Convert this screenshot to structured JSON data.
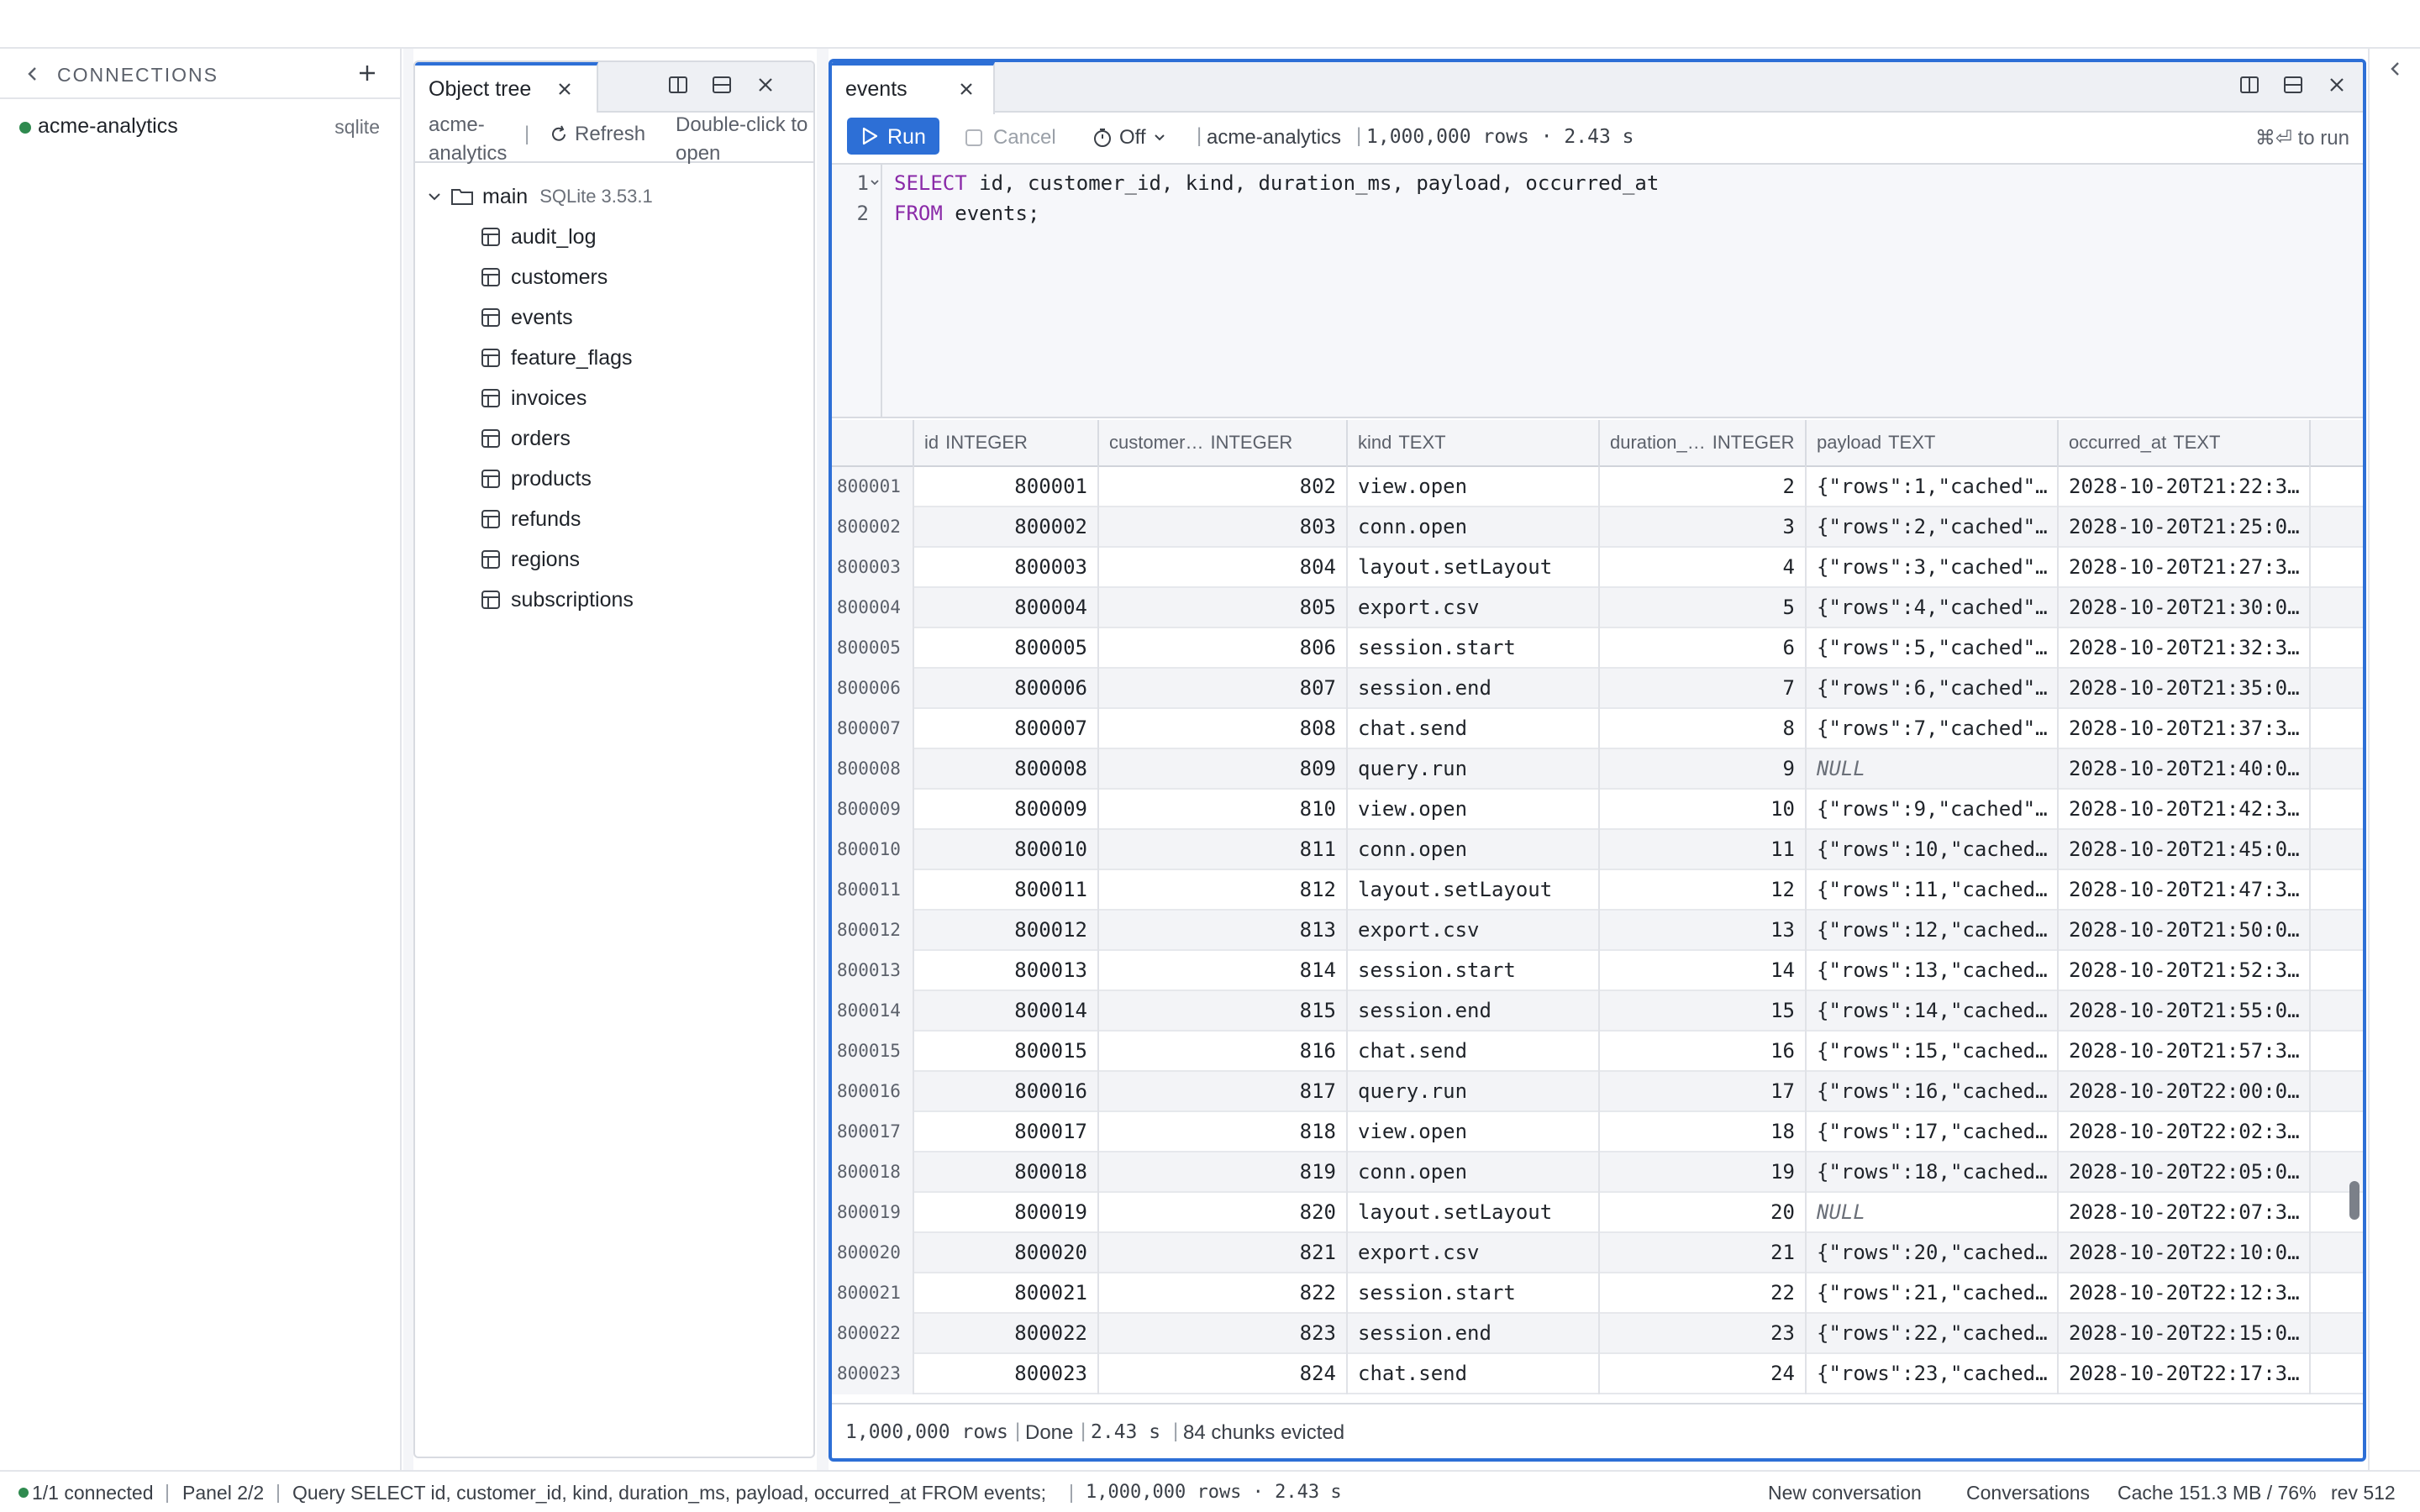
{
  "connections": {
    "title": "CONNECTIONS",
    "items": [
      {
        "name": "acme-analytics",
        "engine": "sqlite",
        "status_color": "#2f8a4f"
      }
    ]
  },
  "tree_panel": {
    "tab_label": "Object tree",
    "db_name": "acme-analytics",
    "refresh_label": "Refresh",
    "hint": "Double-click to open",
    "schema": {
      "name": "main",
      "version": "SQLite 3.53.1"
    },
    "tables": [
      "audit_log",
      "customers",
      "events",
      "feature_flags",
      "invoices",
      "orders",
      "products",
      "refunds",
      "regions",
      "subscriptions"
    ]
  },
  "main_panel": {
    "tab_label": "events",
    "run_label": "Run",
    "cancel_label": "Cancel",
    "timer_label": "Off",
    "connection": "acme-analytics",
    "result_info": "1,000,000 rows · 2.43 s",
    "shortcut_hint": "⌘⏎ to run",
    "editor_lines": [
      {
        "n": "1",
        "kw": "SELECT",
        "rest": " id, customer_id, kind, duration_ms, payload, occurred_at"
      },
      {
        "n": "2",
        "kw": "FROM",
        "rest": " events;"
      }
    ],
    "columns": [
      {
        "name": "id",
        "type": "INTEGER"
      },
      {
        "name": "customer…",
        "type": "INTEGER"
      },
      {
        "name": "kind",
        "type": "TEXT"
      },
      {
        "name": "duration_…",
        "type": "INTEGER"
      },
      {
        "name": "payload",
        "type": "TEXT"
      },
      {
        "name": "occurred_at",
        "type": "TEXT"
      }
    ],
    "rows": [
      [
        "800001",
        "800001",
        "802",
        "view.open",
        "2",
        "{\"rows\":1,\"cached\"…",
        "2028-10-20T21:22:3…"
      ],
      [
        "800002",
        "800002",
        "803",
        "conn.open",
        "3",
        "{\"rows\":2,\"cached\"…",
        "2028-10-20T21:25:0…"
      ],
      [
        "800003",
        "800003",
        "804",
        "layout.setLayout",
        "4",
        "{\"rows\":3,\"cached\"…",
        "2028-10-20T21:27:3…"
      ],
      [
        "800004",
        "800004",
        "805",
        "export.csv",
        "5",
        "{\"rows\":4,\"cached\"…",
        "2028-10-20T21:30:0…"
      ],
      [
        "800005",
        "800005",
        "806",
        "session.start",
        "6",
        "{\"rows\":5,\"cached\"…",
        "2028-10-20T21:32:3…"
      ],
      [
        "800006",
        "800006",
        "807",
        "session.end",
        "7",
        "{\"rows\":6,\"cached\"…",
        "2028-10-20T21:35:0…"
      ],
      [
        "800007",
        "800007",
        "808",
        "chat.send",
        "8",
        "{\"rows\":7,\"cached\"…",
        "2028-10-20T21:37:3…"
      ],
      [
        "800008",
        "800008",
        "809",
        "query.run",
        "9",
        "NULL",
        "2028-10-20T21:40:0…"
      ],
      [
        "800009",
        "800009",
        "810",
        "view.open",
        "10",
        "{\"rows\":9,\"cached\"…",
        "2028-10-20T21:42:3…"
      ],
      [
        "800010",
        "800010",
        "811",
        "conn.open",
        "11",
        "{\"rows\":10,\"cached…",
        "2028-10-20T21:45:0…"
      ],
      [
        "800011",
        "800011",
        "812",
        "layout.setLayout",
        "12",
        "{\"rows\":11,\"cached…",
        "2028-10-20T21:47:3…"
      ],
      [
        "800012",
        "800012",
        "813",
        "export.csv",
        "13",
        "{\"rows\":12,\"cached…",
        "2028-10-20T21:50:0…"
      ],
      [
        "800013",
        "800013",
        "814",
        "session.start",
        "14",
        "{\"rows\":13,\"cached…",
        "2028-10-20T21:52:3…"
      ],
      [
        "800014",
        "800014",
        "815",
        "session.end",
        "15",
        "{\"rows\":14,\"cached…",
        "2028-10-20T21:55:0…"
      ],
      [
        "800015",
        "800015",
        "816",
        "chat.send",
        "16",
        "{\"rows\":15,\"cached…",
        "2028-10-20T21:57:3…"
      ],
      [
        "800016",
        "800016",
        "817",
        "query.run",
        "17",
        "{\"rows\":16,\"cached…",
        "2028-10-20T22:00:0…"
      ],
      [
        "800017",
        "800017",
        "818",
        "view.open",
        "18",
        "{\"rows\":17,\"cached…",
        "2028-10-20T22:02:3…"
      ],
      [
        "800018",
        "800018",
        "819",
        "conn.open",
        "19",
        "{\"rows\":18,\"cached…",
        "2028-10-20T22:05:0…"
      ],
      [
        "800019",
        "800019",
        "820",
        "layout.setLayout",
        "20",
        "NULL",
        "2028-10-20T22:07:3…"
      ],
      [
        "800020",
        "800020",
        "821",
        "export.csv",
        "21",
        "{\"rows\":20,\"cached…",
        "2028-10-20T22:10:0…"
      ],
      [
        "800021",
        "800021",
        "822",
        "session.start",
        "22",
        "{\"rows\":21,\"cached…",
        "2028-10-20T22:12:3…"
      ],
      [
        "800022",
        "800022",
        "823",
        "session.end",
        "23",
        "{\"rows\":22,\"cached…",
        "2028-10-20T22:15:0…"
      ],
      [
        "800023",
        "800023",
        "824",
        "chat.send",
        "24",
        "{\"rows\":23,\"cached…",
        "2028-10-20T22:17:3…"
      ]
    ],
    "status": {
      "rows": "1,000,000 rows",
      "state": "Done",
      "time": "2.43 s",
      "evicted": "84 chunks evicted"
    }
  },
  "bottom_bar": {
    "connected": "1/1 connected",
    "panel": "Panel 2/2",
    "query": "Query SELECT id, customer_id, kind, duration_ms, payload, occurred_at FROM events;",
    "result": "1,000,000 rows · 2.43 s",
    "new_conversation": "New conversation",
    "conversations": "Conversations",
    "cache": "Cache 151.3 MB / 76%",
    "rev": "rev 512"
  },
  "theme": {
    "accent": "#2d6fd6",
    "ok": "#2f8a4f",
    "keyword": "#8a2aa8"
  }
}
